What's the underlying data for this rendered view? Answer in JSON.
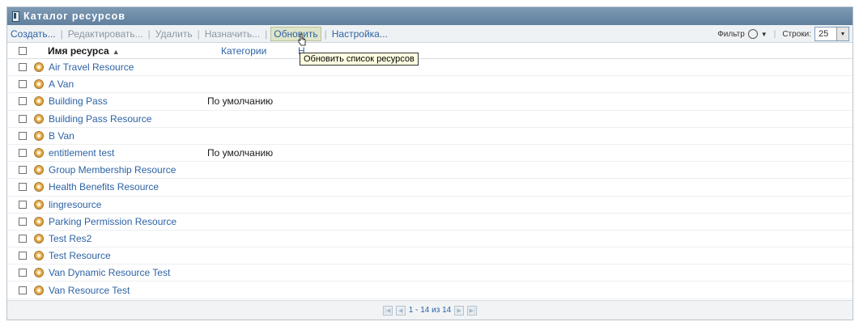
{
  "window": {
    "title": "Каталог ресурсов"
  },
  "toolbar": {
    "create": "Создать...",
    "edit": "Редактировать...",
    "delete": "Удалить",
    "assign": "Назначить...",
    "refresh": "Обновить",
    "settings": "Настройка...",
    "filter_label": "Фильтр",
    "rows_label": "Строки:",
    "rows_value": "25"
  },
  "tooltip": {
    "text": "Обновить список ресурсов"
  },
  "table": {
    "col_name": "Имя ресурса",
    "col_categories": "Категории",
    "col_categories2": "Н... ..."
  },
  "resources": [
    {
      "name": "Air Travel Resource",
      "category": ""
    },
    {
      "name": "A Van",
      "category": ""
    },
    {
      "name": "Building Pass",
      "category": "По умолчанию"
    },
    {
      "name": "Building Pass Resource",
      "category": ""
    },
    {
      "name": "B Van",
      "category": ""
    },
    {
      "name": "entitlement test",
      "category": "По умолчанию"
    },
    {
      "name": "Group Membership Resource",
      "category": ""
    },
    {
      "name": "Health Benefits Resource",
      "category": ""
    },
    {
      "name": "lingresource",
      "category": ""
    },
    {
      "name": "Parking Permission Resource",
      "category": ""
    },
    {
      "name": "Test Res2",
      "category": ""
    },
    {
      "name": "Test Resource",
      "category": ""
    },
    {
      "name": "Van Dynamic Resource Test",
      "category": ""
    },
    {
      "name": "Van Resource Test",
      "category": ""
    }
  ],
  "pager": {
    "text": "1 - 14 из 14"
  }
}
